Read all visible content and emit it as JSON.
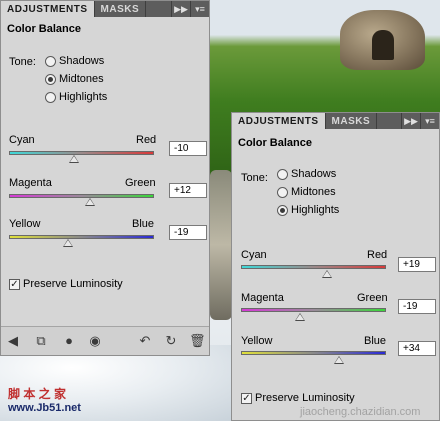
{
  "tabs": {
    "adjustments": "ADJUSTMENTS",
    "masks": "MASKS",
    "forward_icon": "double-arrow-icon",
    "menu_icon": "panel-menu-icon"
  },
  "panel_left": {
    "title": "Color Balance",
    "tone_label": "Tone:",
    "tones": [
      {
        "label": "Shadows",
        "selected": false
      },
      {
        "label": "Midtones",
        "selected": true
      },
      {
        "label": "Highlights",
        "selected": false
      }
    ],
    "sliders": [
      {
        "left": "Cyan",
        "right": "Red",
        "value": "-10",
        "position": 0.44,
        "colors": [
          "#3fd8d8",
          "#d83a3a"
        ]
      },
      {
        "left": "Magenta",
        "right": "Green",
        "value": "+12",
        "position": 0.56,
        "colors": [
          "#d63ad6",
          "#3ad63a"
        ]
      },
      {
        "left": "Yellow",
        "right": "Blue",
        "value": "-19",
        "position": 0.4,
        "colors": [
          "#e0e03a",
          "#2a2ad6"
        ]
      }
    ],
    "preserve_label": "Preserve Luminosity",
    "preserve_checked": true
  },
  "panel_right": {
    "title": "Color Balance",
    "tone_label": "Tone:",
    "tones": [
      {
        "label": "Shadows",
        "selected": false
      },
      {
        "label": "Midtones",
        "selected": false
      },
      {
        "label": "Highlights",
        "selected": true
      }
    ],
    "sliders": [
      {
        "left": "Cyan",
        "right": "Red",
        "value": "+19",
        "position": 0.59,
        "colors": [
          "#3fd8d8",
          "#d83a3a"
        ]
      },
      {
        "left": "Magenta",
        "right": "Green",
        "value": "-19",
        "position": 0.4,
        "colors": [
          "#d63ad6",
          "#3ad63a"
        ]
      },
      {
        "left": "Yellow",
        "right": "Blue",
        "value": "+34",
        "position": 0.67,
        "colors": [
          "#e0e03a",
          "#2a2ad6"
        ]
      }
    ],
    "preserve_label": "Preserve Luminosity",
    "preserve_checked": true
  },
  "bottom_icons": [
    "back-arrow-icon",
    "clip-layer-icon",
    "visibility-dot-icon",
    "eye-icon",
    "previous-state-icon",
    "reset-icon",
    "trash-icon"
  ],
  "watermarks": {
    "cn": "脚 本 之 家",
    "site": "www.Jb51.net",
    "corner": "jiaocheng.chazidian.com"
  }
}
